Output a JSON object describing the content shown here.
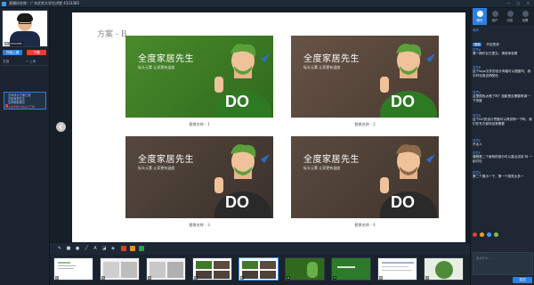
{
  "window": {
    "title": "直播间名称：广东优秀大学生讲堂 4333385",
    "controls": "— □ ✕"
  },
  "left_panel": {
    "camera_label": "ID: 4333385",
    "start_button": "开始上课",
    "stop_button": "下课",
    "tab_docs": "文档",
    "tab_upload": "+ 上传",
    "doc_lines": [
      "空间设计方案汇报",
      "全度家居先生",
      "空间模板展示"
    ],
    "doc_sub": "全度家居方案设计汇报"
  },
  "slide": {
    "title": "方案 - B",
    "cards": [
      {
        "heading": "全度家居先生",
        "subheading": "标头元素   让家更有温度",
        "caption": "替换名称 - 1",
        "bg": "#3a7a24"
      },
      {
        "heading": "全度家居先生",
        "subheading": "标头元素   让家更有温度",
        "caption": "替换名称 - 2",
        "bg": "#5b4a3e"
      },
      {
        "heading": "全度家居先生",
        "subheading": "标头元素   让家更有温度",
        "caption": "替换名称 - 3",
        "bg": "#4a3f38"
      },
      {
        "heading": "全度家居先生",
        "subheading": "标头元素   让家更有温度",
        "caption": "替换名称 - 4",
        "bg": "#4f4238"
      }
    ],
    "logo_text": "DO",
    "prev_icon": "chevron-left",
    "next_icon": "chevron-right"
  },
  "toolbar": {
    "tools": [
      "pen-icon",
      "rect-icon",
      "circle-icon",
      "line-icon",
      "text-icon",
      "eraser-icon",
      "highlight-icon"
    ],
    "text_tool_label": "A",
    "colors": [
      "#e0392b",
      "#f08c1a",
      "#2ba14a"
    ]
  },
  "thumbnails": [
    {
      "num": "1"
    },
    {
      "num": "2"
    },
    {
      "num": "3"
    },
    {
      "num": "4"
    },
    {
      "num": "5"
    },
    {
      "num": "6"
    },
    {
      "num": "7"
    },
    {
      "num": "8"
    },
    {
      "num": "9"
    }
  ],
  "right_panel": {
    "tabs": [
      {
        "label": "聊天",
        "active": true
      },
      {
        "label": "用户",
        "active": false
      },
      {
        "label": "问答",
        "active": false
      },
      {
        "label": "设置",
        "active": false
      }
    ],
    "messages": [
      {
        "name": "老师",
        "text": "开启签到",
        "pill": "签到"
      },
      {
        "name": "学员A",
        "text": "第一期作业已提交，请老师查看"
      },
      {
        "name": "学员B",
        "text": "这个logo文件的设计风格可以借鉴吗，我平时也用这种配色"
      },
      {
        "name": "学员C",
        "text": "这里颜色太暗了吗？投影是否需要再调一下亮度"
      },
      {
        "name": "学员D",
        "text": "这个DO的设计思路可以再说明一下吗，我们在写方案时经常需要"
      },
      {
        "name": "学员E",
        "text": "不太人"
      },
      {
        "name": "学员F",
        "text": "课程第二个案例的部分可以重点讲讲 吗 一起讨论"
      },
      {
        "name": "学员G",
        "text": "第二个展示一下，第一个感觉太多一"
      }
    ],
    "input_placeholder": "说点什么...",
    "send_label": "发送"
  }
}
